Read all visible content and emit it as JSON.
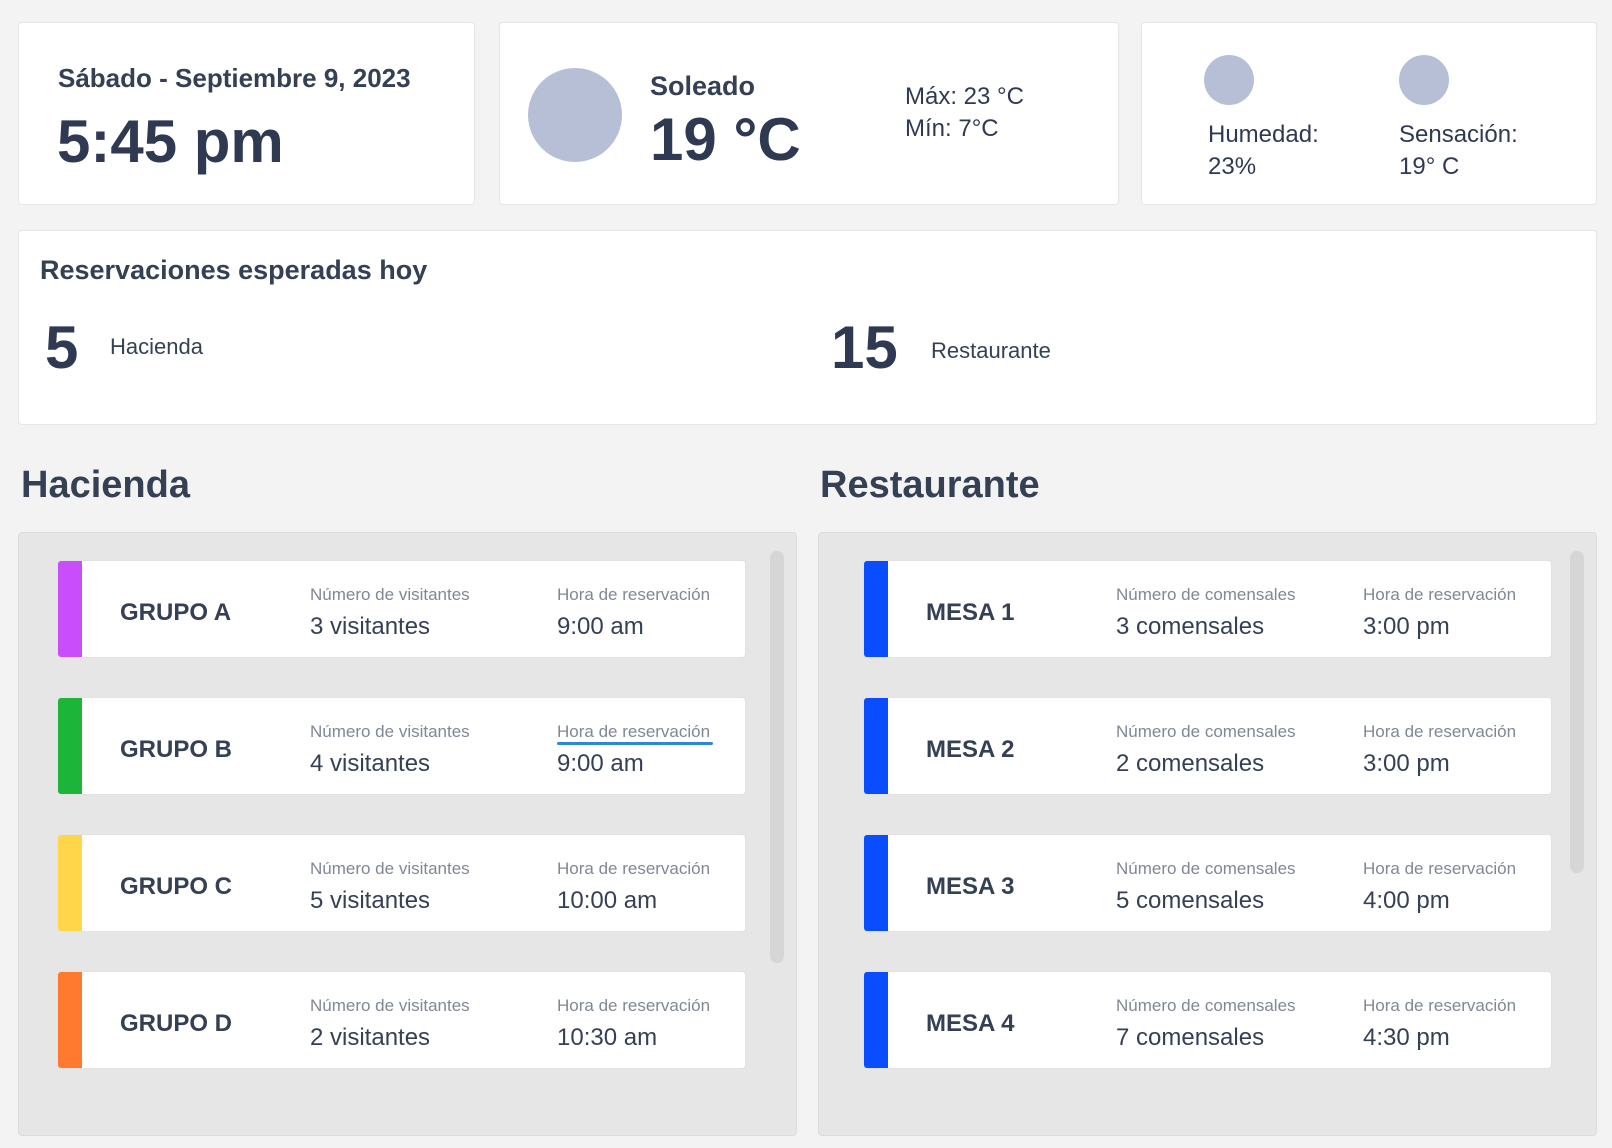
{
  "header": {
    "date": "Sábado - Septiembre 9, 2023",
    "time": "5:45 pm"
  },
  "weather": {
    "icon": "sun-icon",
    "condition": "Soleado",
    "temperature": "19 °C",
    "max": "Máx: 23 °C",
    "min": "Mín: 7°C"
  },
  "conditions": {
    "humidity_icon": "humidity-icon",
    "humidity_label": "Humedad:",
    "humidity_value": "23%",
    "feels_icon": "feels-like-icon",
    "feels_label": "Sensación:",
    "feels_value": "19° C"
  },
  "reservations": {
    "title": "Reservaciones esperadas hoy",
    "hacienda_count": "5",
    "hacienda_label": "Hacienda",
    "restaurant_count": "15",
    "restaurant_label": "Restaurante"
  },
  "hacienda": {
    "title": "Hacienda",
    "rows": [
      {
        "name": "GRUPO A",
        "count_label": "Número de visitantes",
        "count": "3 visitantes",
        "time_label": "Hora de reservación",
        "time": "9:00 am",
        "color": "#c94dfa"
      },
      {
        "name": "GRUPO B",
        "count_label": "Número de visitantes",
        "count": "4 visitantes",
        "time_label": "Hora de reservación",
        "time": "9:00 am",
        "color": "#1db539"
      },
      {
        "name": "GRUPO C",
        "count_label": "Número de visitantes",
        "count": "5 visitantes",
        "time_label": "Hora de reservación",
        "time": "10:00 am",
        "color": "#ffd54a"
      },
      {
        "name": "GRUPO D",
        "count_label": "Número de visitantes",
        "count": "2 visitantes",
        "time_label": "Hora de reservación",
        "time": "10:30 am",
        "color": "#ff7a2e"
      }
    ]
  },
  "restaurant": {
    "title": "Restaurante",
    "rows": [
      {
        "name": "MESA 1",
        "count_label": "Número de comensales",
        "count": "3 comensales",
        "time_label": "Hora de reservación",
        "time": "3:00 pm",
        "color": "#0a4dff"
      },
      {
        "name": "MESA 2",
        "count_label": "Número de comensales",
        "count": "2 comensales",
        "time_label": "Hora de reservación",
        "time": "3:00 pm",
        "color": "#0a4dff"
      },
      {
        "name": "MESA 3",
        "count_label": "Número de comensales",
        "count": "5 comensales",
        "time_label": "Hora de reservación",
        "time": "4:00 pm",
        "color": "#0a4dff"
      },
      {
        "name": "MESA 4",
        "count_label": "Número de comensales",
        "count": "7 comensales",
        "time_label": "Hora de reservación",
        "time": "4:30 pm",
        "color": "#0a4dff"
      }
    ]
  }
}
